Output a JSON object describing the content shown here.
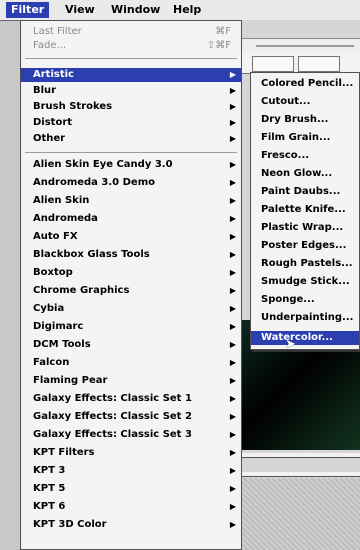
{
  "menubar": {
    "items": [
      {
        "label": "Filter",
        "active": true
      },
      {
        "label": "View",
        "active": false
      },
      {
        "label": "Window",
        "active": false
      },
      {
        "label": "Help",
        "active": false
      }
    ]
  },
  "filter_menu": {
    "top": [
      {
        "label": "Last Filter",
        "shortcut": "⌘F",
        "disabled": true
      },
      {
        "label": "Fade...",
        "shortcut": "⇧⌘F",
        "disabled": true
      }
    ],
    "middle": [
      {
        "label": "Artistic",
        "highlighted": true
      },
      {
        "label": "Blur"
      },
      {
        "label": "Brush Strokes"
      },
      {
        "label": "Distort"
      },
      {
        "label": "Other"
      }
    ],
    "plugins": [
      "Alien Skin Eye Candy 3.0",
      "Andromeda 3.0 Demo",
      "Alien Skin",
      "Andromeda",
      "Auto FX",
      "Blackbox Glass Tools",
      "Boxtop",
      "Chrome Graphics",
      "Cybia",
      "Digimarc",
      "DCM Tools",
      "Falcon",
      "Flaming Pear",
      "Galaxy Effects: Classic Set 1",
      "Galaxy Effects: Classic Set 2",
      "Galaxy Effects: Classic Set 3",
      "KPT Filters",
      "KPT 3",
      "KPT 5",
      "KPT 6",
      "KPT 3D Color"
    ]
  },
  "artistic_submenu": {
    "items": [
      {
        "label": "Colored Pencil..."
      },
      {
        "label": "Cutout..."
      },
      {
        "label": "Dry Brush..."
      },
      {
        "label": "Film Grain..."
      },
      {
        "label": "Fresco..."
      },
      {
        "label": "Neon Glow..."
      },
      {
        "label": "Paint Daubs..."
      },
      {
        "label": "Palette Knife..."
      },
      {
        "label": "Plastic Wrap..."
      },
      {
        "label": "Poster Edges..."
      },
      {
        "label": "Rough Pastels..."
      },
      {
        "label": "Smudge Stick..."
      },
      {
        "label": "Sponge..."
      },
      {
        "label": "Underpainting..."
      },
      {
        "label": "Watercolor...",
        "highlighted": true
      }
    ]
  },
  "colors": {
    "highlight": "#2c3fb0",
    "menu_bg": "#f4f4f4",
    "disabled_text": "#8a8a8a"
  },
  "icons": {
    "submenu_arrow": "▶",
    "cursor": "pointer-arrow-icon"
  }
}
